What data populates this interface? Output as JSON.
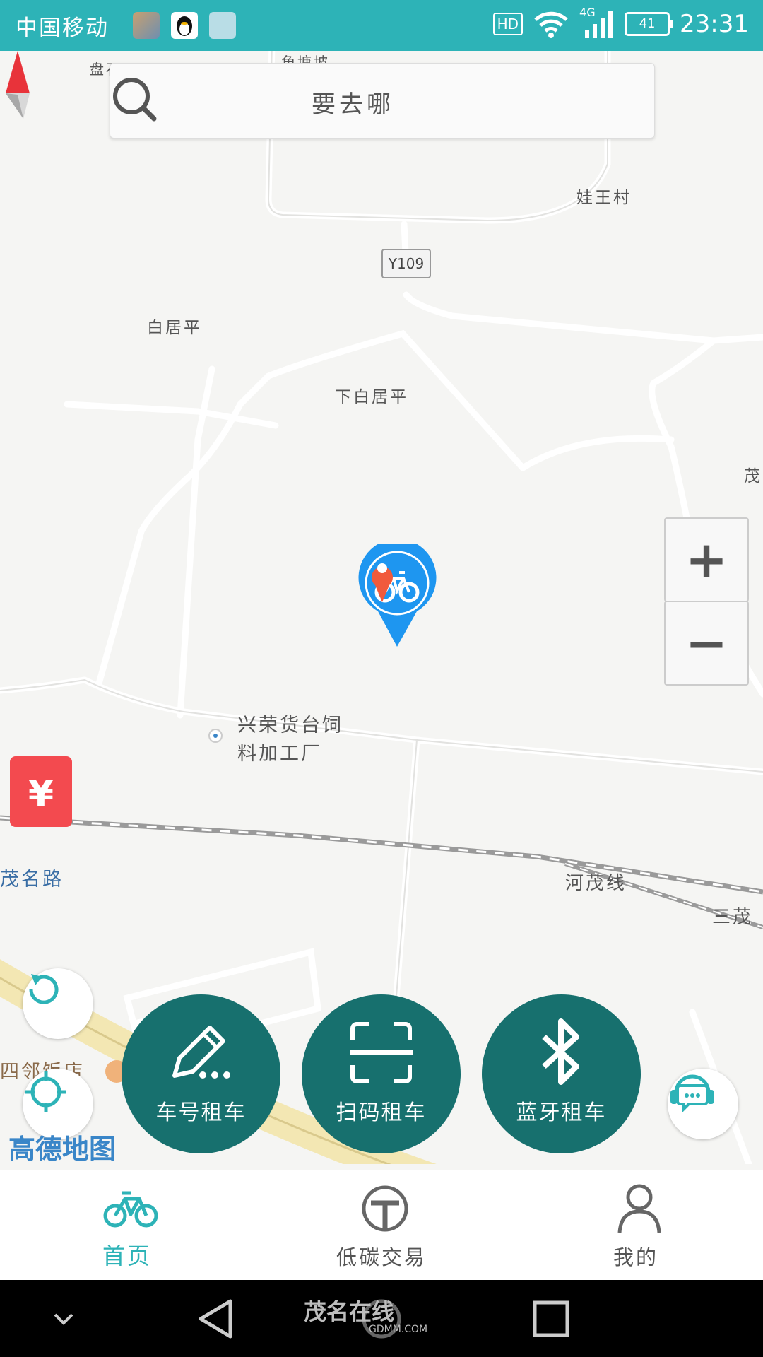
{
  "status_bar": {
    "carrier": "中国移动",
    "hd": "HD",
    "network": "4G",
    "battery": "41",
    "time": "23:31"
  },
  "search": {
    "placeholder": "要去哪"
  },
  "map": {
    "labels": [
      "盘石",
      "角塘坡",
      "娃王村",
      "白居平",
      "下白居平",
      "茂",
      "兴荣货台饲",
      "料加工厂",
      "茂名路",
      "河茂线",
      "三茂",
      "四邻饭店"
    ],
    "road_sign": "Y109",
    "provider": "高德地图"
  },
  "zoom": {
    "in_label": "+",
    "out_label": "−"
  },
  "red_packet": {
    "symbol": "¥"
  },
  "actions": [
    {
      "label": "车号租车",
      "icon": "pencil-icon"
    },
    {
      "label": "扫码租车",
      "icon": "scan-icon"
    },
    {
      "label": "蓝牙租车",
      "icon": "bluetooth-icon"
    }
  ],
  "nav": [
    {
      "label": "首页",
      "icon": "bike-icon",
      "active": true
    },
    {
      "label": "低碳交易",
      "icon": "t-circle-icon",
      "active": false
    },
    {
      "label": "我的",
      "icon": "user-icon",
      "active": false
    }
  ],
  "watermark": {
    "main": "茂名在线",
    "sub": "GDMM.COM"
  },
  "colors": {
    "accent": "#2db3b7",
    "action": "#17706e",
    "pin_blue": "#1e96f0",
    "red": "#f34a4f"
  }
}
